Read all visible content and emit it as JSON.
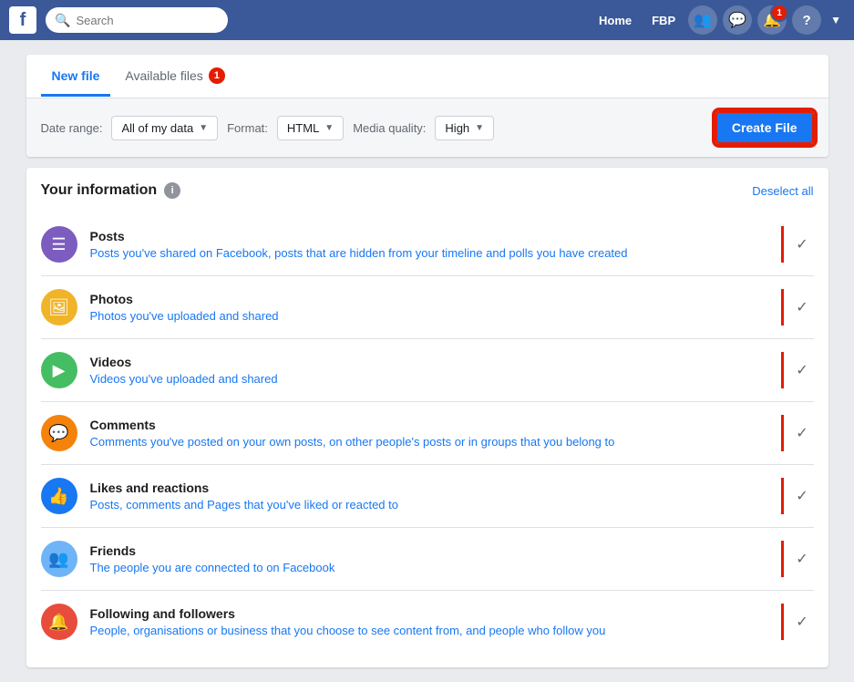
{
  "navbar": {
    "logo_text": "f",
    "search_placeholder": "Search",
    "links": [
      "Home",
      "FBP"
    ],
    "icons": [
      {
        "name": "friends-icon",
        "symbol": "👥",
        "badge": null
      },
      {
        "name": "messenger-icon",
        "symbol": "💬",
        "badge": null
      },
      {
        "name": "notifications-icon",
        "symbol": "🔔",
        "badge": "1"
      },
      {
        "name": "help-icon",
        "symbol": "?",
        "badge": null
      }
    ],
    "dropdown_symbol": "▼"
  },
  "tabs": {
    "items": [
      {
        "label": "New file",
        "active": true,
        "badge": null
      },
      {
        "label": "Available files",
        "active": false,
        "badge": "1"
      }
    ]
  },
  "filters": {
    "date_range_label": "Date range:",
    "date_range_value": "All of my data",
    "format_label": "Format:",
    "format_value": "HTML",
    "media_quality_label": "Media quality:",
    "media_quality_value": "High",
    "create_button_label": "Create File"
  },
  "your_information": {
    "title": "Your information",
    "deselect_label": "Deselect all",
    "rows": [
      {
        "icon_class": "purple",
        "icon_symbol": "☰",
        "title": "Posts",
        "desc": "Posts you've shared on Facebook, posts that are hidden from your timeline and polls you have created",
        "checked": true
      },
      {
        "icon_class": "yellow",
        "icon_symbol": "🖼",
        "title": "Photos",
        "desc": "Photos you've uploaded and shared",
        "checked": true
      },
      {
        "icon_class": "green",
        "icon_symbol": "▶",
        "title": "Videos",
        "desc": "Videos you've uploaded and shared",
        "checked": true
      },
      {
        "icon_class": "orange",
        "icon_symbol": "💬",
        "title": "Comments",
        "desc": "Comments you've posted on your own posts, on other people's posts or in groups that you belong to",
        "checked": true
      },
      {
        "icon_class": "blue",
        "icon_symbol": "👍",
        "title": "Likes and reactions",
        "desc": "Posts, comments and Pages that you've liked or reacted to",
        "checked": true
      },
      {
        "icon_class": "blue-light",
        "icon_symbol": "👥",
        "title": "Friends",
        "desc": "The people you are connected to on Facebook",
        "checked": true
      },
      {
        "icon_class": "red",
        "icon_symbol": "🔔",
        "title": "Following and followers",
        "desc": "People, organisations or business that you choose to see content from, and people who follow you",
        "checked": true
      }
    ]
  }
}
